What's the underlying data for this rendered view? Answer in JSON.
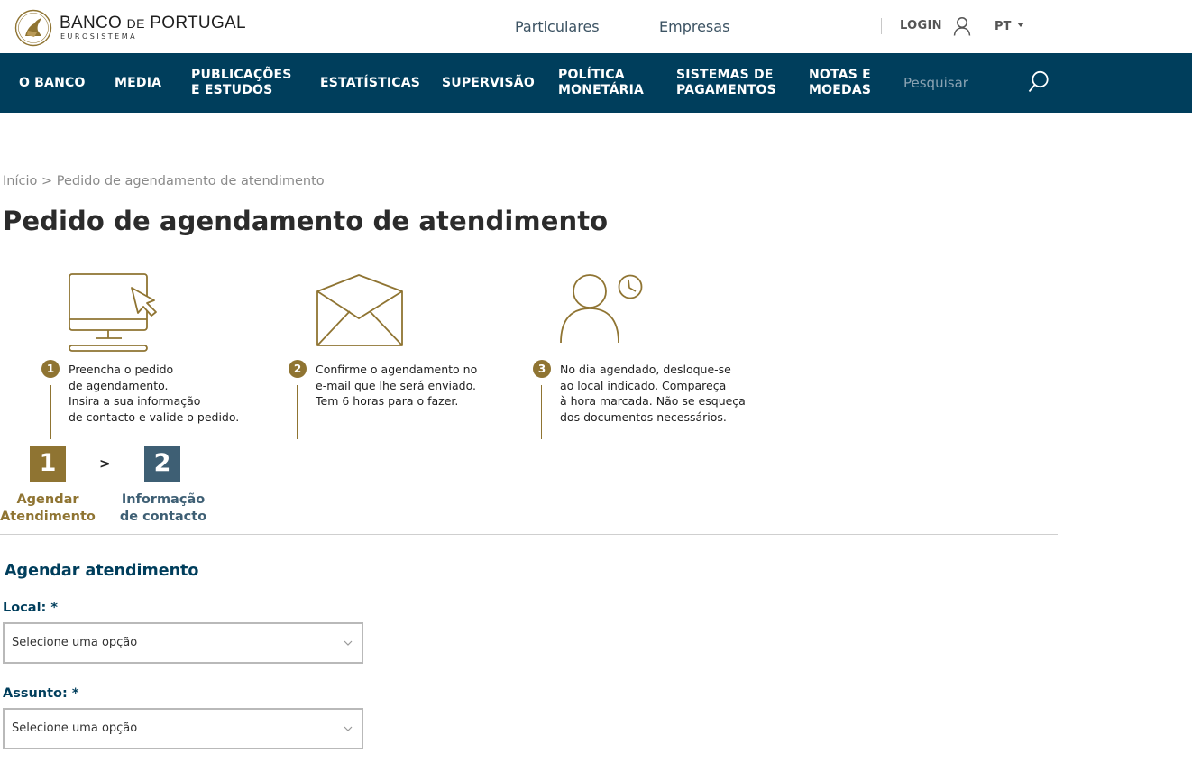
{
  "header": {
    "logo": {
      "name_part1": "BANCO ",
      "name_small": "DE",
      "name_part2": " PORTUGAL",
      "subtitle": "EUROSISTEMA"
    },
    "segments": [
      "Particulares",
      "Empresas"
    ],
    "login_label": "LOGIN",
    "language": "PT"
  },
  "nav": {
    "items": [
      {
        "line1": "O BANCO",
        "line2": ""
      },
      {
        "line1": "MEDIA",
        "line2": ""
      },
      {
        "line1": "PUBLICAÇÕES",
        "line2": "E ESTUDOS"
      },
      {
        "line1": "ESTATÍSTICAS",
        "line2": ""
      },
      {
        "line1": "SUPERVISÃO",
        "line2": ""
      },
      {
        "line1": "POLÍTICA",
        "line2": "MONETÁRIA"
      },
      {
        "line1": "SISTEMAS DE",
        "line2": "PAGAMENTOS"
      },
      {
        "line1": "NOTAS E",
        "line2": "MOEDAS"
      }
    ],
    "search_placeholder": "Pesquisar"
  },
  "breadcrumb": {
    "home": "Início",
    "separator": ">",
    "current": "Pedido de agendamento de atendimento"
  },
  "page_title": "Pedido de agendamento de atendimento",
  "steps": [
    {
      "number": "1",
      "icon": "computer-cursor-icon",
      "lines": [
        "Preencha o pedido",
        "de agendamento.",
        "Insira a sua informação",
        "de contacto e valide o pedido."
      ]
    },
    {
      "number": "2",
      "icon": "envelope-icon",
      "lines": [
        "Confirme o agendamento no",
        "e-mail que lhe será enviado.",
        "Tem 6 horas para o fazer."
      ]
    },
    {
      "number": "3",
      "icon": "person-clock-icon",
      "lines": [
        "No dia agendado, desloque-se",
        "ao local indicado. Compareça",
        "à hora marcada. Não se esqueça",
        "dos documentos necessários."
      ]
    }
  ],
  "progress": {
    "separator": ">",
    "items": [
      {
        "number": "1",
        "line1": "Agendar",
        "line2": "Atendimento"
      },
      {
        "number": "2",
        "line1": "Informação",
        "line2": "de contacto"
      }
    ]
  },
  "form": {
    "section_title": "Agendar atendimento",
    "fields": [
      {
        "label": "Local: *",
        "value": "Selecione uma opção"
      },
      {
        "label": "Assunto: *",
        "value": "Selecione uma opção"
      }
    ]
  },
  "colors": {
    "nav_bg": "#003e5c",
    "gold": "#8f7432",
    "step2_blue": "#3e5f74"
  }
}
